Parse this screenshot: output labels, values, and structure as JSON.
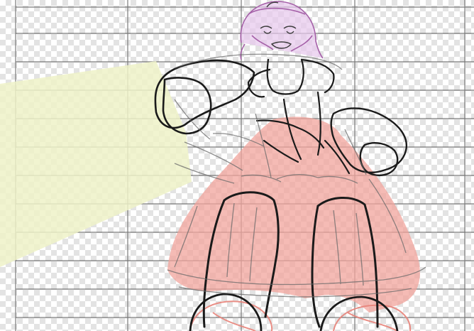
{
  "app": {
    "type": "drawing-canvas"
  },
  "canvas": {
    "background": "transparency-checkerboard",
    "grid_color": "#7a7a7a",
    "layers": [
      {
        "name": "light-cone",
        "color": "#eef2c8"
      },
      {
        "name": "skirt-fill",
        "color": "#f2a49c"
      },
      {
        "name": "head-sketch",
        "color": "#a561a8"
      },
      {
        "name": "line-sketch",
        "color": "#1a1a1a"
      }
    ]
  }
}
